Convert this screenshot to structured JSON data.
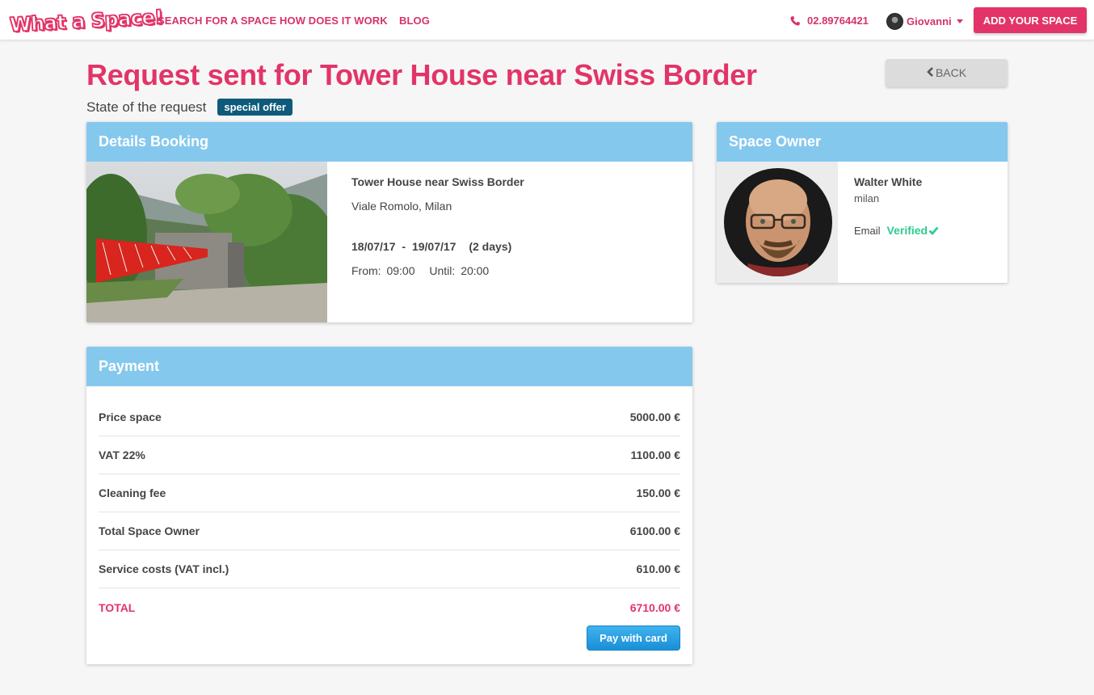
{
  "nav": {
    "logo_text": "What a Space!",
    "links": [
      "SEARCH FOR A SPACE",
      "HOW DOES IT WORK",
      "BLOG"
    ],
    "phone": "02.89764421",
    "user_name": "Giovanni",
    "add_space_label": "ADD YOUR SPACE"
  },
  "header": {
    "title": "Request sent for Tower House near Swiss Border",
    "state_label": "State of the request",
    "state_badge": "special offer",
    "back_label": "BACK"
  },
  "booking": {
    "heading": "Details Booking",
    "space_name": "Tower House near Swiss Border",
    "address": "Viale Romolo, Milan",
    "date_from": "18/07/17",
    "date_sep": "-",
    "date_to": "19/07/17",
    "duration": "(2 days)",
    "from_label": "From:",
    "from_time": "09:00",
    "until_label": "Until:",
    "until_time": "20:00"
  },
  "owner": {
    "heading": "Space Owner",
    "name": "Walter White",
    "city": "milan",
    "email_label": "Email",
    "email_status": "Verified"
  },
  "payment": {
    "heading": "Payment",
    "rows": [
      {
        "label": "Price space",
        "value": "5000.00 €"
      },
      {
        "label": "VAT 22%",
        "value": "1100.00 €"
      },
      {
        "label": "Cleaning fee",
        "value": "150.00 €"
      },
      {
        "label": "Total Space Owner",
        "value": "6100.00 €"
      },
      {
        "label": "Service costs (VAT incl.)",
        "value": "610.00 €"
      },
      {
        "label": "TOTAL",
        "value": "6710.00 €"
      }
    ],
    "pay_button": "Pay with card"
  },
  "colors": {
    "brand": "#e23468",
    "panel_header": "#85c8ee",
    "badge": "#0e5a7a",
    "verified": "#2ecc8f",
    "pay_button": "#2a9fe0"
  },
  "icons": [
    "phone-icon",
    "chevron-left-icon",
    "check-icon",
    "caret-down-icon"
  ]
}
